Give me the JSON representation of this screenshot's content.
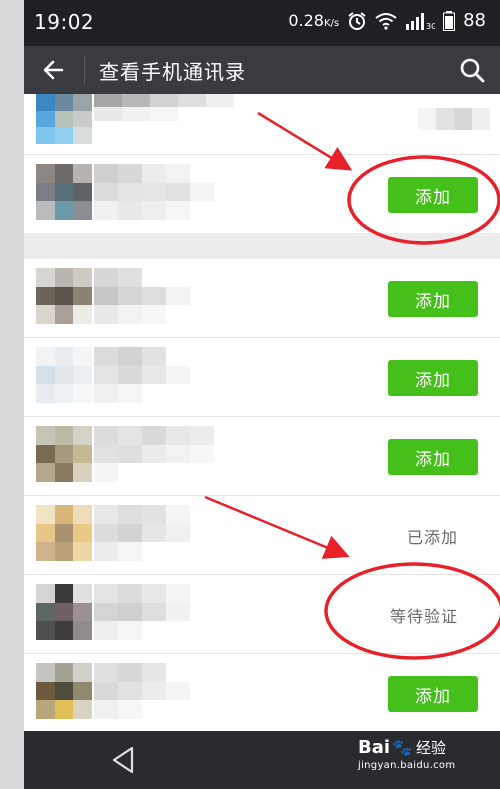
{
  "status_bar": {
    "time": "19:02",
    "speed": "0.28",
    "speed_unit": "K/s",
    "network": "3G",
    "battery": "88"
  },
  "toolbar": {
    "title": "查看手机通讯录"
  },
  "contacts": [
    {
      "status": "",
      "kind": "blurred"
    },
    {
      "status": "添加",
      "kind": "button"
    },
    {
      "status": "添加",
      "kind": "button"
    },
    {
      "status": "添加",
      "kind": "button"
    },
    {
      "status": "添加",
      "kind": "button"
    },
    {
      "status": "已添加",
      "kind": "text"
    },
    {
      "status": "等待验证",
      "kind": "text"
    },
    {
      "status": "添加",
      "kind": "button"
    }
  ],
  "watermark": {
    "brand": "Bai",
    "brand_suffix": "经验",
    "url": "jingyan.baidu.com"
  },
  "colors": {
    "statusbar_bg": "#1f2023",
    "toolbar_bg": "#3a3b3f",
    "add_button": "#45c01a",
    "annotation": "#e8202a",
    "navbar_bg": "#2a2b2e"
  },
  "icons": {
    "back": "arrow-left-icon",
    "search": "search-icon",
    "alarm": "alarm-clock-icon",
    "wifi": "wifi-icon",
    "signal": "signal-icon",
    "battery": "battery-icon",
    "nav_back": "triangle-back-icon",
    "paw": "baidu-paw-icon"
  }
}
